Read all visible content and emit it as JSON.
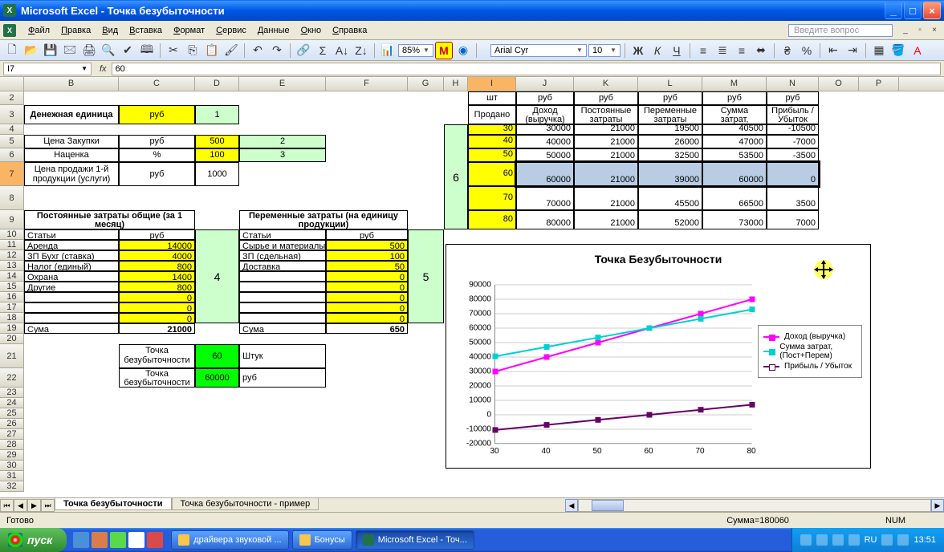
{
  "titlebar": {
    "title": "Microsoft Excel - Точка безубыточности"
  },
  "menu": {
    "file": "Файл",
    "edit": "Правка",
    "view": "Вид",
    "insert": "Вставка",
    "format": "Формат",
    "service": "Сервис",
    "data": "Данные",
    "window": "Окно",
    "help": "Справка",
    "question": "Введите вопрос"
  },
  "toolbar": {
    "zoom": "85%",
    "font": "Arial Cyr",
    "size": "10"
  },
  "formula": {
    "cell": "I7",
    "value": "60"
  },
  "columns": [
    "B",
    "C",
    "D",
    "E",
    "F",
    "G",
    "H",
    "I",
    "J",
    "K",
    "L",
    "M",
    "N",
    "O",
    "P"
  ],
  "labels": {
    "currency_unit": "Денежная единица",
    "rub": "руб",
    "one": "1",
    "purchase_price": "Цена Закупки",
    "markup": "Наценка",
    "percent": "%",
    "selling_price": "Цена продажи 1-й продукции (услуги)",
    "fixed_costs_hdr": "Постоянные затраты общие (за 1 месяц)",
    "var_costs_hdr": "Переменные затраты (на единицу продукции)",
    "items": "Статьи",
    "sum": "Сума",
    "rent": "Аренда",
    "acct": "ЗП Бухг (ставка)",
    "tax": "Налог (единый)",
    "guard": "Охрана",
    "other": "Другие",
    "raw": "Сырье и материалы",
    "piece": "ЗП (сдельная)",
    "delivery": "Доставка",
    "bep_label": "Точка безубыточности",
    "pieces": "Штук",
    "sold": "Продано",
    "sht": "шт",
    "income": "Доход (выручка)",
    "fixed": "Постоянные затраты",
    "variable": "Переменные затраты",
    "total_costs": "Сумма затрат, (Пост+Перем)",
    "profit": "Прибыль / Убыток"
  },
  "values": {
    "pp": "500",
    "markup": "100",
    "sp": "1000",
    "two": "2",
    "three": "3",
    "four": "4",
    "five": "5",
    "six": "6",
    "rent": "14000",
    "acct": "4000",
    "tax": "800",
    "guard": "1400",
    "other": "800",
    "zero": "0",
    "fixed_sum": "21000",
    "raw": "500",
    "piece": "100",
    "delivery": "50",
    "var_sum": "650",
    "bep_units": "60",
    "bep_rub": "60000"
  },
  "table": {
    "rows": [
      {
        "q": "30",
        "inc": "30000",
        "fix": "21000",
        "var": "19500",
        "tot": "40500",
        "prof": "-10500"
      },
      {
        "q": "40",
        "inc": "40000",
        "fix": "21000",
        "var": "26000",
        "tot": "47000",
        "prof": "-7000"
      },
      {
        "q": "50",
        "inc": "50000",
        "fix": "21000",
        "var": "32500",
        "tot": "53500",
        "prof": "-3500"
      },
      {
        "q": "60",
        "inc": "60000",
        "fix": "21000",
        "var": "39000",
        "tot": "60000",
        "prof": "0"
      },
      {
        "q": "70",
        "inc": "70000",
        "fix": "21000",
        "var": "45500",
        "tot": "66500",
        "prof": "3500"
      },
      {
        "q": "80",
        "inc": "80000",
        "fix": "21000",
        "var": "52000",
        "tot": "73000",
        "prof": "7000"
      }
    ]
  },
  "chart_data": {
    "type": "line",
    "title": "Точка Безубыточности",
    "x": [
      30,
      40,
      50,
      60,
      70,
      80
    ],
    "ylim": [
      -20000,
      90000
    ],
    "series": [
      {
        "name": "Доход (выручка)",
        "color": "#ff00ff",
        "values": [
          30000,
          40000,
          50000,
          60000,
          70000,
          80000
        ]
      },
      {
        "name": "Сумма затрат, (Пост+Перем)",
        "color": "#00d0d0",
        "values": [
          40500,
          47000,
          53500,
          60000,
          66500,
          73000
        ]
      },
      {
        "name": "Прибыль / Убыток",
        "color": "#660066",
        "values": [
          -10500,
          -7000,
          -3500,
          0,
          3500,
          7000
        ]
      }
    ],
    "yticks": [
      -20000,
      -10000,
      0,
      10000,
      20000,
      30000,
      40000,
      50000,
      60000,
      70000,
      80000,
      90000
    ]
  },
  "tabs": {
    "active": "Точка безубыточности",
    "other": "Точка безубыточности - пример"
  },
  "status": {
    "ready": "Готово",
    "sum": "Сумма=180060",
    "num": "NUM"
  },
  "taskbar": {
    "start": "пуск",
    "t1": "драйвера звуковой ...",
    "t2": "Бонусы",
    "t3": "Microsoft Excel - Точ...",
    "lang": "RU",
    "time": "13:51"
  }
}
